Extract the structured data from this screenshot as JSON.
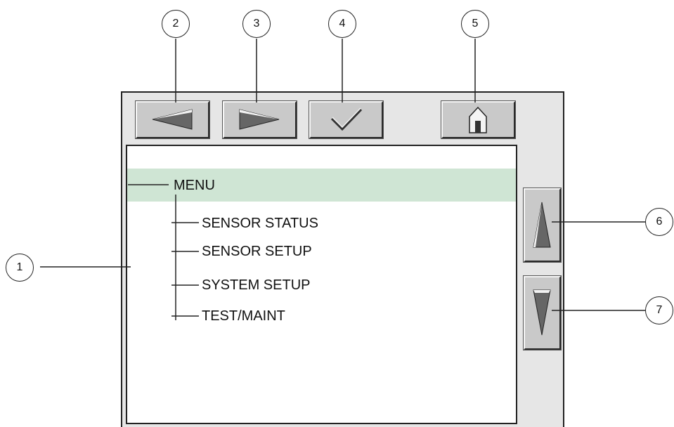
{
  "toolbar": {
    "back_icon": "left-triangle-icon",
    "forward_icon": "right-triangle-icon",
    "confirm_icon": "checkmark-icon",
    "home_icon": "house-icon"
  },
  "scroll": {
    "up_icon": "up-triangle-icon",
    "down_icon": "down-triangle-icon"
  },
  "menu": {
    "title": "MENU",
    "items": [
      {
        "label": "SENSOR STATUS"
      },
      {
        "label": "SENSOR SETUP"
      },
      {
        "label": "SYSTEM SETUP"
      },
      {
        "label": "TEST/MAINT"
      }
    ]
  },
  "callouts": [
    "1",
    "2",
    "3",
    "4",
    "5",
    "6",
    "7"
  ],
  "colors": {
    "highlight": "#cfe5d4",
    "panel": "#e6e6e6",
    "button": "#c9c9c9"
  }
}
